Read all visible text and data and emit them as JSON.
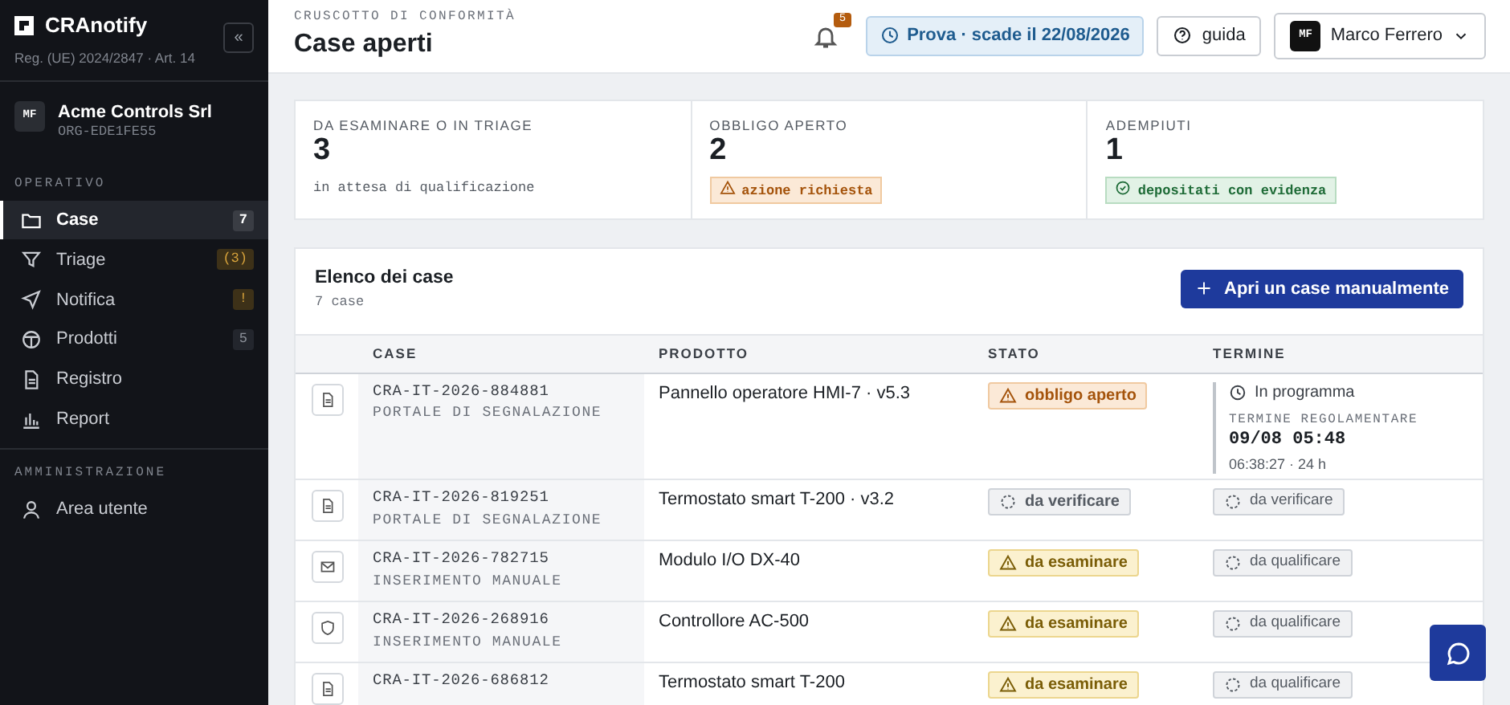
{
  "sidebar": {
    "brand": "CRAnotify",
    "regulation": "Reg. (UE) 2024/2847 · Art. 14",
    "collapse_button": "«",
    "org": {
      "initials": "MF",
      "name": "Acme Controls Srl",
      "id": "ORG-EDE1FE55"
    },
    "sections": [
      {
        "label": "OPERATIVO",
        "items": [
          {
            "label": "Case",
            "badge": {
              "text": "7",
              "kind": "neutral"
            },
            "selected": true
          },
          {
            "label": "Triage",
            "badge": {
              "text": "(3)",
              "kind": "warning"
            },
            "selected": false
          },
          {
            "label": "Notifica",
            "badge": {
              "text": "!",
              "kind": "warning"
            },
            "selected": false
          },
          {
            "label": "Prodotti",
            "badge": {
              "text": "5",
              "kind": "muted"
            },
            "selected": false
          },
          {
            "label": "Registro",
            "selected": false
          },
          {
            "label": "Report",
            "selected": false
          }
        ]
      },
      {
        "label": "AMMINISTRAZIONE",
        "items": [
          {
            "label": "Area utente",
            "selected": false
          }
        ]
      }
    ]
  },
  "header": {
    "eyebrow": "CRUSCOTTO DI CONFORMITÀ",
    "title": "Case aperti",
    "notifications": "5",
    "trial": "Prova · scade il 22/08/2026",
    "help": "guida",
    "user": {
      "initials": "MF",
      "name": "Marco Ferrero"
    }
  },
  "stats": [
    {
      "label": "DA ESAMINARE O IN TRIAGE",
      "value": "3",
      "note": "in attesa di qualificazione",
      "kind": "text"
    },
    {
      "label": "OBBLIGO APERTO",
      "value": "2",
      "note": "azione richiesta",
      "kind": "warning"
    },
    {
      "label": "ADEMPIUTI",
      "value": "1",
      "note": "depositati con evidenza",
      "kind": "success"
    }
  ],
  "cases": {
    "title": "Elenco dei case",
    "count": "7 case",
    "new_button": "Apri un case manualmente",
    "columns": [
      "CASE",
      "PRODOTTO",
      "STATO",
      "TERMINE"
    ],
    "rows": [
      {
        "id": "CRA-IT-2026-884881",
        "source": "PORTALE DI SEGNALAZIONE",
        "product": "Pannello operatore HMI-7 · v5.3",
        "status": {
          "text": "obbligo aperto",
          "kind": "open"
        },
        "deadline": {
          "kind": "scheduled",
          "state": "In programma",
          "label": "TERMINE REGOLAMENTARE",
          "date": "09/08 05:48",
          "remaining": "06:38:27 · 24 h"
        }
      },
      {
        "id": "CRA-IT-2026-819251",
        "source": "PORTALE DI SEGNALAZIONE",
        "product": "Termostato smart T-200 · v3.2",
        "status": {
          "text": "da verificare",
          "kind": "pending"
        },
        "deadline": {
          "kind": "pending",
          "state": "da verificare"
        }
      },
      {
        "id": "CRA-IT-2026-782715",
        "source": "INSERIMENTO MANUALE",
        "product": "Modulo I/O DX-40",
        "status": {
          "text": "da esaminare",
          "kind": "review"
        },
        "deadline": {
          "kind": "pending",
          "state": "da qualificare"
        }
      },
      {
        "id": "CRA-IT-2026-268916",
        "source": "INSERIMENTO MANUALE",
        "product": "Controllore AC-500",
        "status": {
          "text": "da esaminare",
          "kind": "review"
        },
        "deadline": {
          "kind": "pending",
          "state": "da qualificare"
        }
      },
      {
        "id": "CRA-IT-2026-686812",
        "product": "Termostato smart T-200",
        "status": {
          "text": "da esaminare",
          "kind": "review"
        },
        "deadline": {
          "kind": "pending",
          "state": "da qualificare"
        }
      }
    ]
  }
}
